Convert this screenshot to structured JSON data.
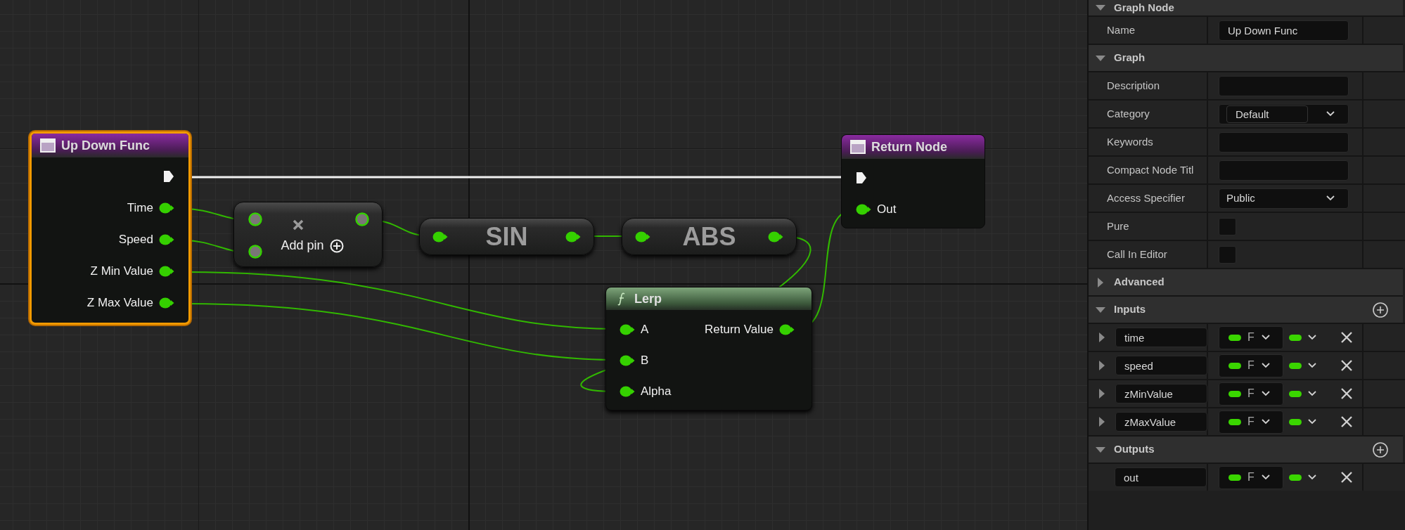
{
  "graph": {
    "nodes": [
      {
        "kind": "function_entry",
        "title": "Up Down Func",
        "selected": true,
        "outputs": [
          "Time",
          "Speed",
          "Z Min Value",
          "Z Max Value"
        ]
      },
      {
        "kind": "operator",
        "selected": false,
        "action": "Add pin"
      },
      {
        "kind": "compact",
        "selected": false,
        "title": "SIN"
      },
      {
        "kind": "compact",
        "selected": false,
        "title": "ABS"
      },
      {
        "kind": "function_call",
        "selected": false,
        "title": "Lerp",
        "inputs": [
          "A",
          "B",
          "Alpha"
        ],
        "outputs": [
          "Return Value"
        ]
      },
      {
        "kind": "function_result",
        "selected": false,
        "title": "Return Node",
        "inputs": [
          "Out"
        ]
      }
    ]
  },
  "details": {
    "sections": [
      {
        "kind": "fields",
        "title": "Graph Node",
        "expanded": true,
        "rows": [
          {
            "kind": "text",
            "label": "Name",
            "value": "Up Down Func"
          }
        ]
      },
      {
        "kind": "fields",
        "title": "Graph",
        "expanded": true,
        "rows": [
          {
            "kind": "text",
            "label": "Description"
          },
          {
            "kind": "combo",
            "label": "Category",
            "value": "Default"
          },
          {
            "kind": "text",
            "label": "Keywords"
          },
          {
            "kind": "text",
            "label": "Compact Node Titl"
          },
          {
            "kind": "dropdown",
            "label": "Access Specifier",
            "value": "Public"
          },
          {
            "kind": "checkbox",
            "label": "Pure",
            "checked": false
          },
          {
            "kind": "checkbox",
            "label": "Call In Editor",
            "checked": false
          }
        ]
      },
      {
        "kind": "fields",
        "title": "Advanced",
        "expanded": false
      },
      {
        "kind": "params",
        "title": "Inputs",
        "expanded": true,
        "params": [
          {
            "name": "time",
            "type": "F",
            "expanded": false
          },
          {
            "name": "speed",
            "type": "F",
            "expanded": false
          },
          {
            "name": "zMinValue",
            "type": "F",
            "expanded": false
          },
          {
            "name": "zMaxValue",
            "type": "F",
            "expanded": false
          }
        ]
      },
      {
        "kind": "params",
        "title": "Outputs",
        "expanded": true,
        "params": [
          {
            "name": "out",
            "type": "F"
          }
        ]
      }
    ]
  }
}
